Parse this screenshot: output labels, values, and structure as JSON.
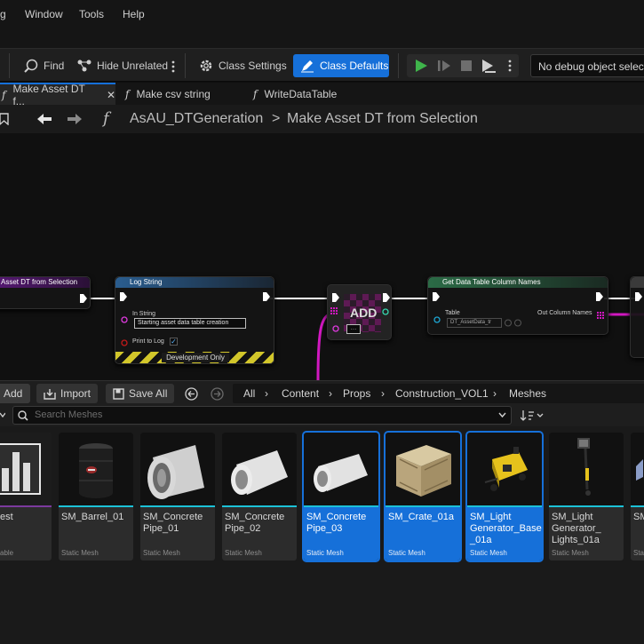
{
  "menubar": {
    "items": [
      "g",
      "Window",
      "Tools",
      "Help"
    ]
  },
  "toolbar": {
    "find_label": "Find",
    "hide_unrelated_label": "Hide Unrelated",
    "class_settings_label": "Class Settings",
    "class_defaults_label": "Class Defaults",
    "debug_object": "No debug object selected"
  },
  "tabs": [
    {
      "label": "Make Asset DT f...",
      "active": true,
      "closable": true
    },
    {
      "label": "Make csv string",
      "active": false
    },
    {
      "label": "WriteDataTable",
      "active": false
    }
  ],
  "breadcrumb": {
    "root": "AsAU_DTGeneration",
    "separator": ">",
    "current": "Make Asset DT from Selection"
  },
  "graph": {
    "entry_node_title": "Asset DT from Selection",
    "log_node": {
      "title": "Log String",
      "in_string_label": "In String",
      "in_string_value": "Starting asset data table creation",
      "print_to_log_label": "Print to Log",
      "footer": "Development Only"
    },
    "add_node": {
      "label": "ADD"
    },
    "column_node": {
      "title": "Get Data Table Column Names",
      "table_label": "Table",
      "table_value": "DT_AssetData_tr",
      "out_label": "Out Column Names"
    }
  },
  "content_browser": {
    "add_label": "Add",
    "import_label": "Import",
    "save_all_label": "Save All",
    "path": [
      "All",
      "Content",
      "Props",
      "Construction_VOL1",
      "Meshes"
    ],
    "search_placeholder": "Search Meshes",
    "assets": [
      {
        "name": "Test",
        "visible_name": "est",
        "type": "able",
        "selected": false
      },
      {
        "name": "SM_Barrel_01",
        "type": "Static Mesh",
        "selected": false
      },
      {
        "name": "SM_Concrete Pipe_01",
        "type": "Static Mesh",
        "selected": false
      },
      {
        "name": "SM_Concrete Pipe_02",
        "type": "Static Mesh",
        "selected": false
      },
      {
        "name": "SM_Concrete Pipe_03",
        "type": "Static Mesh",
        "selected": true
      },
      {
        "name": "SM_Crate_01a",
        "type": "Static Mesh",
        "selected": true
      },
      {
        "name": "SM_Light Generator_Base _01a",
        "type": "Static Mesh",
        "selected": true
      },
      {
        "name": "SM_Light Generator_ Lights_01a",
        "type": "Static Mesh",
        "selected": false
      },
      {
        "name": "SM",
        "type": "Sta",
        "selected": false
      }
    ]
  },
  "colors": {
    "accent": "#1670d9",
    "play": "#3fb54b",
    "mesh_bar": "#1cc1d7",
    "exec_wire": "#ffffff",
    "data_wire": "#d118c0"
  }
}
